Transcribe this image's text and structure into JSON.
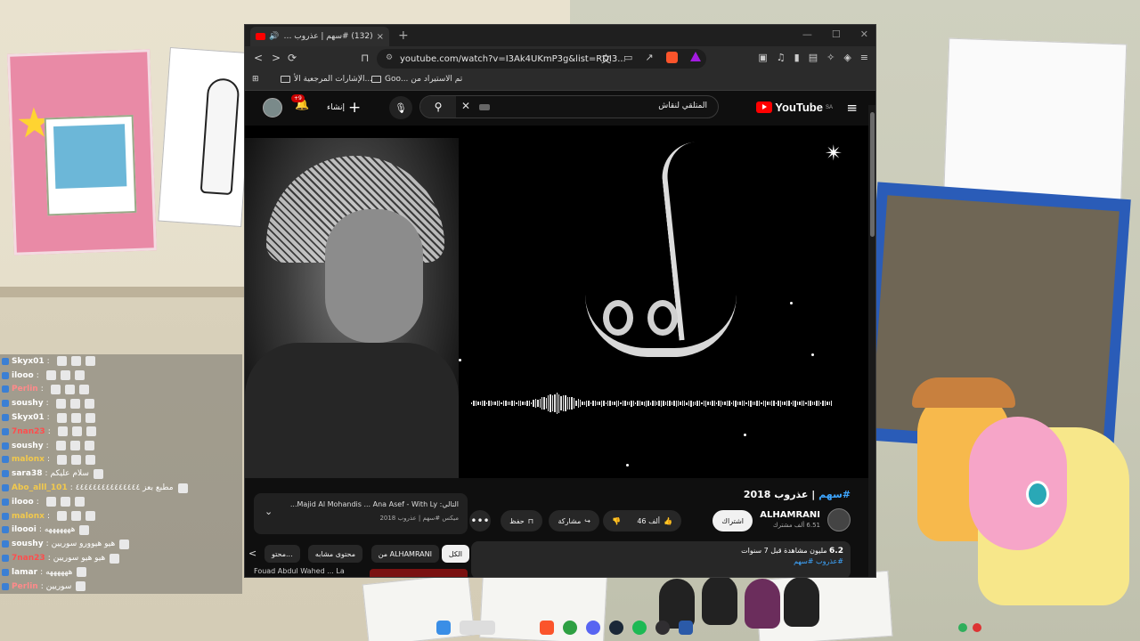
{
  "browser": {
    "tab": {
      "title": "(132) #سهم | عذروب 2018 - ...",
      "close": "×"
    },
    "new_tab": "+",
    "window_controls": [
      "—",
      "☐",
      "✕"
    ],
    "url": "youtube.com/watch?v=I3Ak4UKmP3g&list=RDI3...",
    "bookmarks": {
      "apps": "⊞",
      "folder1": "الإشارات المرجعية الأ...",
      "folder2": "Goo... تم الاستيراد من"
    }
  },
  "youtube": {
    "logo_text": "YouTube",
    "region": "SA",
    "search_placeholder": "المتلقي لنقاش",
    "create_label": "إنشاء",
    "notifications": "+9",
    "video": {
      "title_tag": "#سهم",
      "title_rest": " | عذروب 2018",
      "calligraphy_text": "يا هيم",
      "channel": "ALHAMRANI",
      "subscribers": "6.51 ألف مشترك",
      "subscribe": "اشتراك",
      "likes": "46 ألف",
      "share": "مشاركة",
      "save": "حفظ",
      "more": "•••",
      "views_number": "6.2",
      "views_rest": "مليون مشاهدة قبل 7 سنوات",
      "hashtags": "#عذروب #سهم"
    },
    "mini": {
      "title": "التالي: Majid Al Mohandis ... Ana Asef - With Ly...",
      "subtitle": "ميكس #سهم | عذروب 2018"
    },
    "chips": [
      "الكل",
      "من ALHAMRANI",
      "محتوى مشابه",
      "محتو..."
    ],
    "next_title": "Fouad Abdul Wahed ... La"
  },
  "chat": [
    {
      "user": "Skyx01",
      "msg": "",
      "color": "#ffffff"
    },
    {
      "user": "ilooo",
      "msg": "",
      "color": "#ffffff"
    },
    {
      "user": "Perlin",
      "msg": "",
      "color": "#ff8a8a"
    },
    {
      "user": "soushy",
      "msg": "",
      "color": "#ffffff"
    },
    {
      "user": "Skyx01",
      "msg": "",
      "color": "#ffffff"
    },
    {
      "user": "7nan23",
      "msg": "",
      "color": "#ff4d4d"
    },
    {
      "user": "soushy",
      "msg": "",
      "color": "#ffffff"
    },
    {
      "user": "malonx",
      "msg": "",
      "color": "#f2c94c"
    },
    {
      "user": "sara38",
      "msg": "سلام عليكم",
      "color": "#ffffff"
    },
    {
      "user": "Abo_alll_101",
      "msg": "مطبع بعز ٤٤٤٤٤٤٤٤٤٤٤٤٤٤٤",
      "color": "#f2c94c"
    },
    {
      "user": "ilooo",
      "msg": "",
      "color": "#ffffff"
    },
    {
      "user": "malonx",
      "msg": "",
      "color": "#f2c94c"
    },
    {
      "user": "iloooi",
      "msg": "هههههههه",
      "color": "#ffffff"
    },
    {
      "user": "soushy",
      "msg": "هيو هيوورو سوريين",
      "color": "#ffffff"
    },
    {
      "user": "7nan23",
      "msg": "هيو هيو سوريين",
      "color": "#ff4d4d"
    },
    {
      "user": "lamar",
      "msg": "ههههههه",
      "color": "#ffffff"
    },
    {
      "user": "Perlin",
      "msg": "سوريين",
      "color": "#ff8a8a"
    }
  ],
  "colors": {
    "yt_red": "#ff0000",
    "link_blue": "#3ea6ff",
    "brave_orange": "#fb542b"
  }
}
